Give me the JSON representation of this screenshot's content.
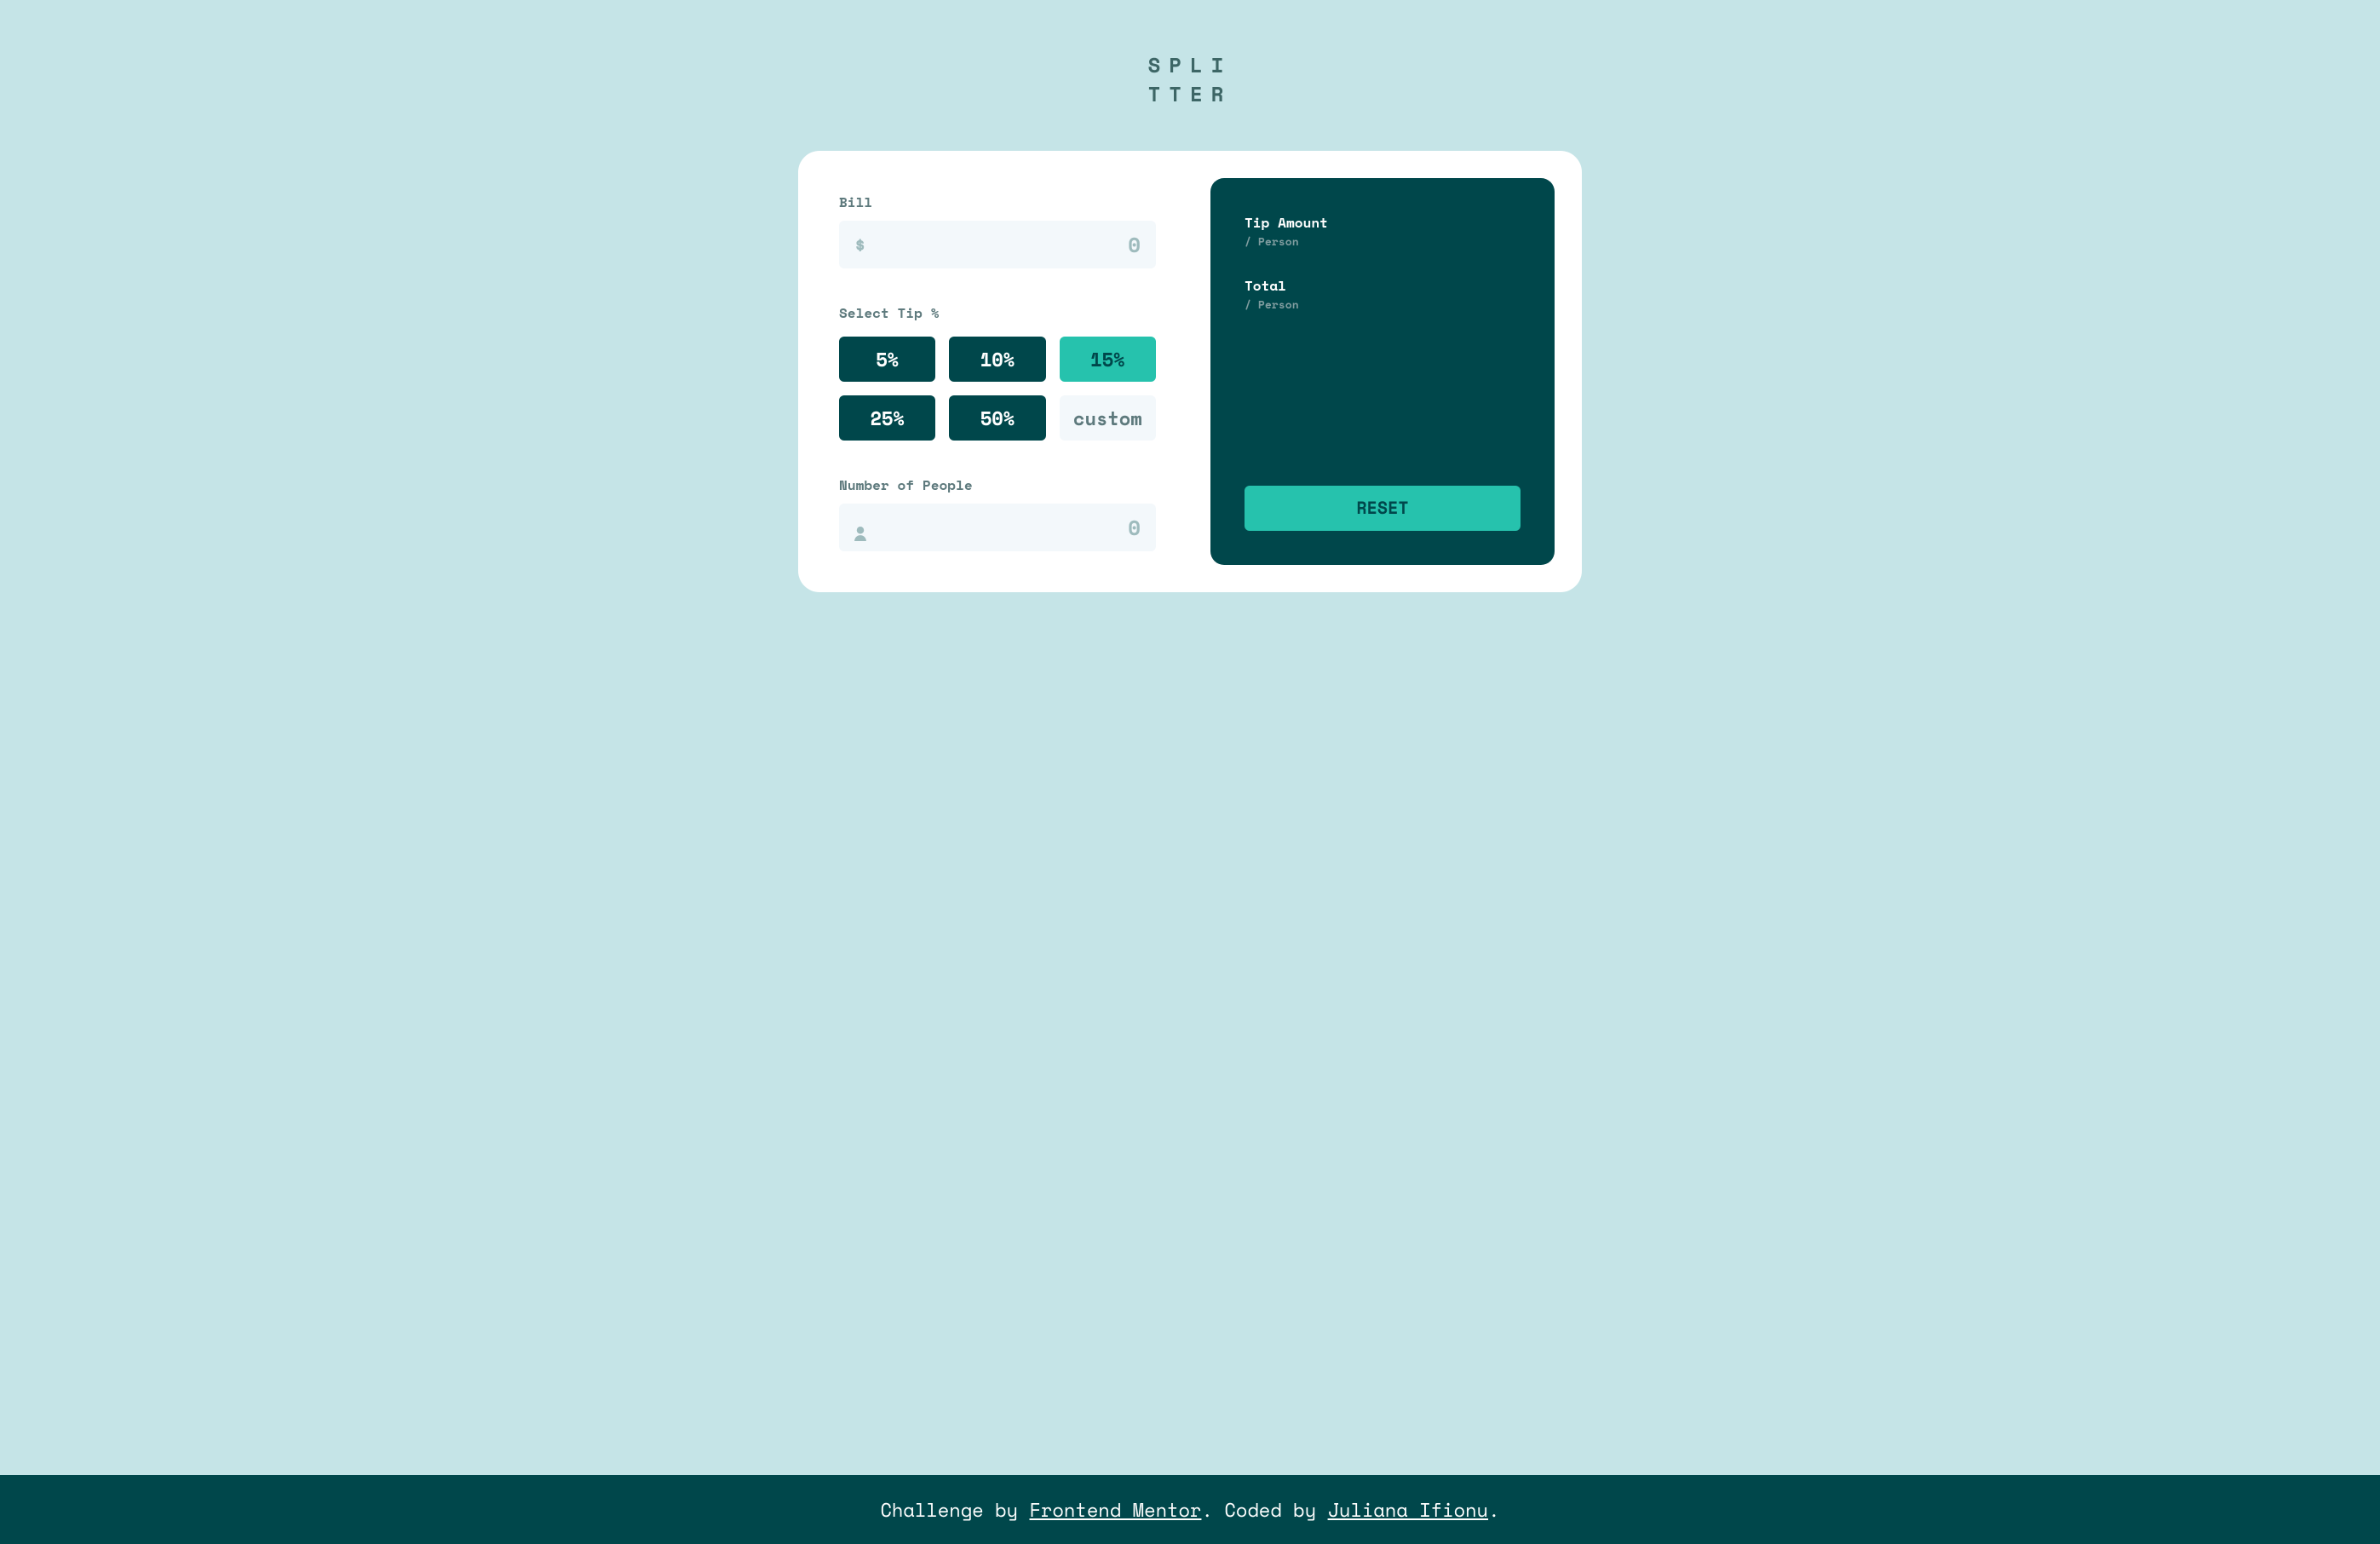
{
  "logo": {
    "line1": "SPLI",
    "line2": "TTER"
  },
  "inputs": {
    "bill_label": "Bill",
    "bill_placeholder": "0",
    "bill_value": "",
    "tip_label": "Select Tip %",
    "tip_options": [
      "5%",
      "10%",
      "15%",
      "25%",
      "50%"
    ],
    "tip_active_index": 2,
    "custom_placeholder": "custom",
    "custom_value": "",
    "people_label": "Number of People",
    "people_placeholder": "0",
    "people_value": ""
  },
  "results": {
    "tip_label": "Tip Amount",
    "tip_sublabel": "/ Person",
    "total_label": "Total",
    "total_sublabel": "/ Person",
    "reset_label": "RESET"
  },
  "footer": {
    "prefix": "Challenge by ",
    "link1_text": "Frontend Mentor",
    "mid": ". Coded by ",
    "link2_text": "Juliana Ifionu",
    "suffix": "."
  },
  "colors": {
    "bg": "#c5e4e7",
    "dark": "#00474b",
    "accent": "#26c2ad",
    "input_bg": "#f3f8fb",
    "label": "#5e7a7d",
    "icon": "#9ebbbd"
  }
}
